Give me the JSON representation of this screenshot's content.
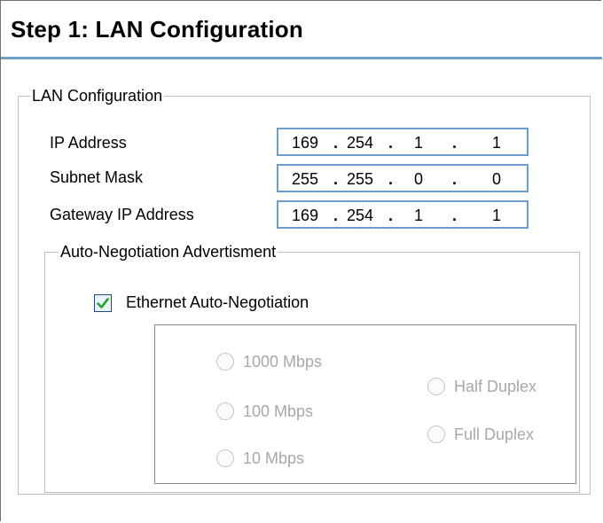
{
  "title": "Step 1: LAN Configuration",
  "lan_group": {
    "legend": "LAN Configuration",
    "fields": [
      {
        "label": "IP Address",
        "octets": [
          "169",
          "254",
          "1",
          "1"
        ]
      },
      {
        "label": "Subnet Mask",
        "octets": [
          "255",
          "255",
          "0",
          "0"
        ]
      },
      {
        "label": "Gateway IP Address",
        "octets": [
          "169",
          "254",
          "1",
          "1"
        ]
      }
    ]
  },
  "auto_group": {
    "legend": "Auto-Negotiation Advertisment",
    "checkbox_label": "Ethernet Auto-Negotiation",
    "checked": true,
    "speeds": [
      "1000 Mbps",
      "100 Mbps",
      "10 Mbps"
    ],
    "duplex": [
      "Half Duplex",
      "Full Duplex"
    ],
    "options_enabled": false
  },
  "colors": {
    "title_rule": "#6da0c7",
    "field_border": "#6b9dd0",
    "check_mark": "#22a022",
    "disabled_text": "#a8a8a8"
  }
}
